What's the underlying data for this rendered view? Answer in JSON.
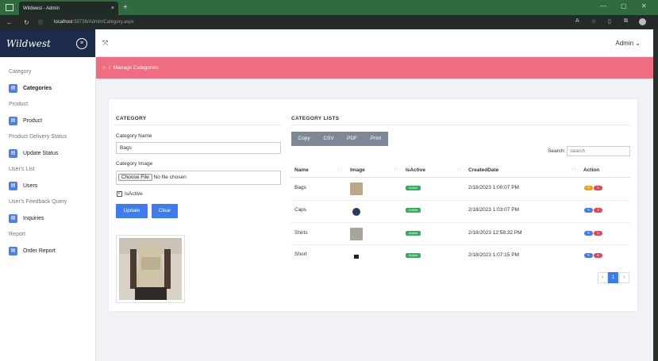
{
  "browser": {
    "tab_title": "Wildwest - Admin",
    "tab_close": "×",
    "new_tab": "+",
    "url_host": "localhost",
    "url_rest": ":50736/Admin/Category.aspx"
  },
  "sidebar": {
    "brand": "Wildwest",
    "sections": [
      {
        "title": "Category",
        "item": "Categories"
      },
      {
        "title": "Product",
        "item": "Product"
      },
      {
        "title": "Product Delivery Status",
        "item": "Update Status"
      },
      {
        "title": "User's List",
        "item": "Users"
      },
      {
        "title": "User's Feedback Query",
        "item": "Inquiries"
      },
      {
        "title": "Report",
        "item": "Order Report"
      }
    ]
  },
  "topbar": {
    "user": "Admin"
  },
  "breadcrumb": {
    "text": "Manage Categories"
  },
  "form": {
    "heading": "CATEGORY",
    "name_label": "Category Name",
    "name_value": "Bags",
    "image_label": "Category Image",
    "choose_file": "Choose File",
    "no_file": "No file chosen",
    "isactive_label": "IsActive",
    "update_label": "Update",
    "clear_label": "Clear"
  },
  "list": {
    "heading": "CATEGORY LISTS",
    "export_buttons": [
      "Copy",
      "CSV",
      "PDF",
      "Print"
    ],
    "search_label": "Search:",
    "search_placeholder": "Search",
    "columns": [
      "Name",
      "Image",
      "IsActive",
      "CreatedDate",
      "Action"
    ],
    "rows": [
      {
        "name": "Bags",
        "status": "Active",
        "date": "2/18/2023 1:00:07 PM"
      },
      {
        "name": "Caps",
        "status": "Active",
        "date": "2/18/2023 1:03:07 PM"
      },
      {
        "name": "Shirts",
        "status": "Active",
        "date": "2/18/2023 12:58:32 PM"
      },
      {
        "name": "Short",
        "status": "Active",
        "date": "2/18/2023 1:07:15 PM"
      }
    ],
    "pagination": {
      "prev": "‹",
      "current": "1",
      "next": "›"
    }
  }
}
